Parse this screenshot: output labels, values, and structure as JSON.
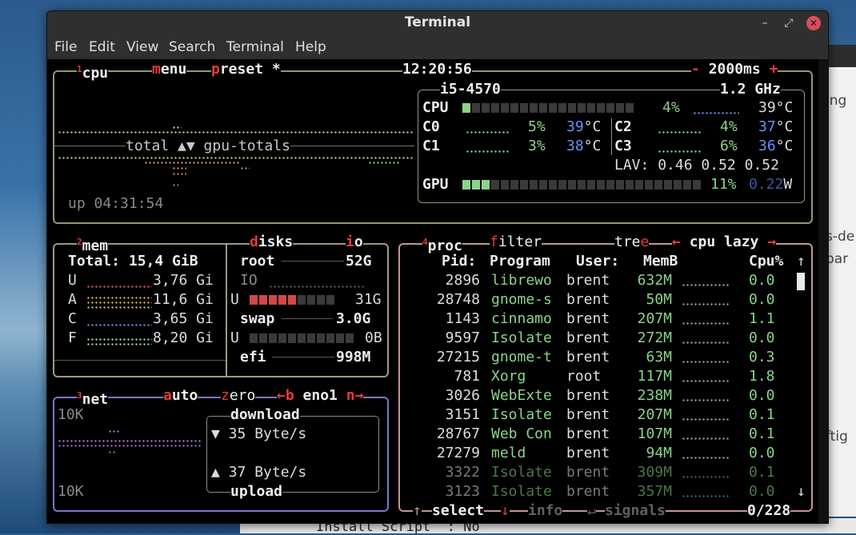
{
  "window": {
    "title": "Terminal"
  },
  "menu": [
    "File",
    "Edit",
    "View",
    "Search",
    "Terminal",
    "Help"
  ],
  "bg": {
    "right_fragments": [
      "ing",
      "s-de",
      "par",
      "ftig"
    ],
    "bottom_line": "Install Script  : No"
  },
  "cpu_box": {
    "num": "1",
    "label": "cpu",
    "menu_first": "m",
    "menu_rest": "enu",
    "preset_first": "p",
    "preset_rest": "reset *",
    "time": "12:20:56",
    "minus": "-",
    "interval": "2000ms",
    "plus": "+",
    "graph_label": "total ▲▼ gpu-totals",
    "uptime": "up 04:31:54",
    "model": "i5-4570",
    "freq": "1.2 GHz",
    "total_label": "CPU",
    "total_pct": "4%",
    "total_temp": "39°C",
    "cores": [
      {
        "label": "C0",
        "pct": "5%",
        "temp": "39",
        "unit": "°C"
      },
      {
        "label": "C1",
        "pct": "3%",
        "temp": "38",
        "unit": "°C"
      },
      {
        "label": "C2",
        "pct": "4%",
        "temp": "37",
        "unit": "°C"
      },
      {
        "label": "C3",
        "pct": "6%",
        "temp": "36",
        "unit": "°C"
      }
    ],
    "lav_label": "LAV:",
    "lav": [
      "0.46",
      "0.52",
      "0.52"
    ],
    "gpu_label": "GPU",
    "gpu_pct": "11%",
    "gpu_w": "0.22",
    "gpu_w_unit": "W",
    "total_fraction": 0.04,
    "gpu_fraction": 0.11
  },
  "mem_box": {
    "num": "2",
    "label": "mem",
    "total": "Total: 15,4 GiB",
    "rows": [
      {
        "k": "U",
        "v": "3,76 Gi"
      },
      {
        "k": "A",
        "v": "11,6 Gi"
      },
      {
        "k": "C",
        "v": "3,65 Gi"
      },
      {
        "k": "F",
        "v": "8,20 Gi"
      }
    ]
  },
  "disks_box": {
    "first": "d",
    "rest": "isks",
    "io_first": "i",
    "io_rest": "o",
    "root": "root",
    "root_size": "52G",
    "io": "IO",
    "root_used_label": "U",
    "root_used": "31G",
    "swap": "swap",
    "swap_size": "3.0G",
    "swap_used_label": "U",
    "swap_used": "0B",
    "efi": "efi",
    "efi_size": "998M",
    "root_fraction": 0.6,
    "swap_fraction": 0.0
  },
  "net_box": {
    "num": "3",
    "label": "net",
    "auto_first": "a",
    "auto_rest": "uto",
    "zero_first": "z",
    "zero_rest": "ero",
    "b_key": "←b",
    "iface": "eno1",
    "n_key": "n→",
    "scale_top": "10K",
    "scale_bottom": "10K",
    "download": "download",
    "dl_arrow": "▼",
    "dl_rate": "35 Byte/s",
    "ul_arrow": "▲",
    "ul_rate": "37 Byte/s",
    "upload": "upload"
  },
  "proc_box": {
    "num": "4",
    "label": "proc",
    "filter_first": "f",
    "filter_rest": "ilter",
    "tree": "tre",
    "tree_last": "e",
    "lazy_left": "←",
    "lazy": "cpu lazy",
    "lazy_right": "→",
    "headers": {
      "pid": "Pid:",
      "program": "Program",
      "user": "User:",
      "mem": "MemB",
      "cpu": "Cpu%"
    },
    "up_arrow": "↑",
    "down_arrow": "↓",
    "rows": [
      {
        "pid": "2896",
        "program": "librewo",
        "user": "brent",
        "mem": "632M",
        "cpu": "0.0"
      },
      {
        "pid": "28748",
        "program": "gnome-s",
        "user": "brent",
        "mem": "50M",
        "cpu": "0.0"
      },
      {
        "pid": "1143",
        "program": "cinnamo",
        "user": "brent",
        "mem": "207M",
        "cpu": "1.1"
      },
      {
        "pid": "9597",
        "program": "Isolate",
        "user": "brent",
        "mem": "272M",
        "cpu": "0.0"
      },
      {
        "pid": "27215",
        "program": "gnome-t",
        "user": "brent",
        "mem": "63M",
        "cpu": "0.3"
      },
      {
        "pid": "781",
        "program": "Xorg",
        "user": "root",
        "mem": "117M",
        "cpu": "1.8"
      },
      {
        "pid": "3026",
        "program": "WebExte",
        "user": "brent",
        "mem": "238M",
        "cpu": "0.0"
      },
      {
        "pid": "3151",
        "program": "Isolate",
        "user": "brent",
        "mem": "207M",
        "cpu": "0.1"
      },
      {
        "pid": "28767",
        "program": "Web Con",
        "user": "brent",
        "mem": "107M",
        "cpu": "0.1"
      },
      {
        "pid": "27279",
        "program": "meld",
        "user": "brent",
        "mem": "94M",
        "cpu": "0.0"
      },
      {
        "pid": "3322",
        "program": "Isolate",
        "user": "brent",
        "mem": "309M",
        "cpu": "0.1"
      },
      {
        "pid": "3123",
        "program": "Isolate",
        "user": "brent",
        "mem": "357M",
        "cpu": "0.0"
      }
    ],
    "footer": {
      "up": "↑",
      "select": "select",
      "down": "↓",
      "info": "info",
      "enter": "↵",
      "signals": "signals",
      "count": "0/228"
    }
  },
  "colors": {
    "cpu_border": "#8a9a7a",
    "mem_border": "#9a9a82",
    "net_border": "#7a76c8",
    "proc_border": "#c49494",
    "accent": "#e23b3b",
    "green": "#8bd38b",
    "blue": "#6b8ef5"
  }
}
